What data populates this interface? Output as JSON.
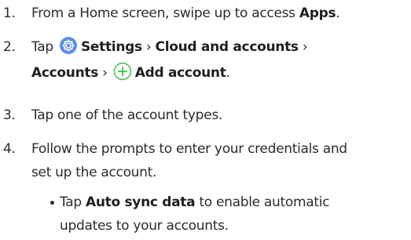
{
  "steps": [
    {
      "number": "1.",
      "pre": "From a Home screen, swipe up to access ",
      "bold": "Apps",
      "post": "."
    },
    {
      "number": "2.",
      "tap": "Tap ",
      "settings_icon": "settings-gear-icon",
      "settings": "Settings",
      "sep1": " › ",
      "cloud": "Cloud and accounts",
      "sep2": " ›",
      "accounts": "Accounts",
      "sep3": " › ",
      "add_icon": "add-circle-icon",
      "add_account": "Add account",
      "end": "."
    },
    {
      "number": "3.",
      "text": "Tap one of the account types."
    },
    {
      "number": "4.",
      "line1": "Follow the prompts to enter your credentials and",
      "line2": "set up the account."
    }
  ],
  "bullet": {
    "pre": "Tap ",
    "bold": "Auto sync data",
    "post": " to enable automatic",
    "line2": "updates to your accounts."
  },
  "colors": {
    "text": "#2b2b2b",
    "settings_icon": "#5b8fe8",
    "add_icon": "#3dbb4f"
  }
}
